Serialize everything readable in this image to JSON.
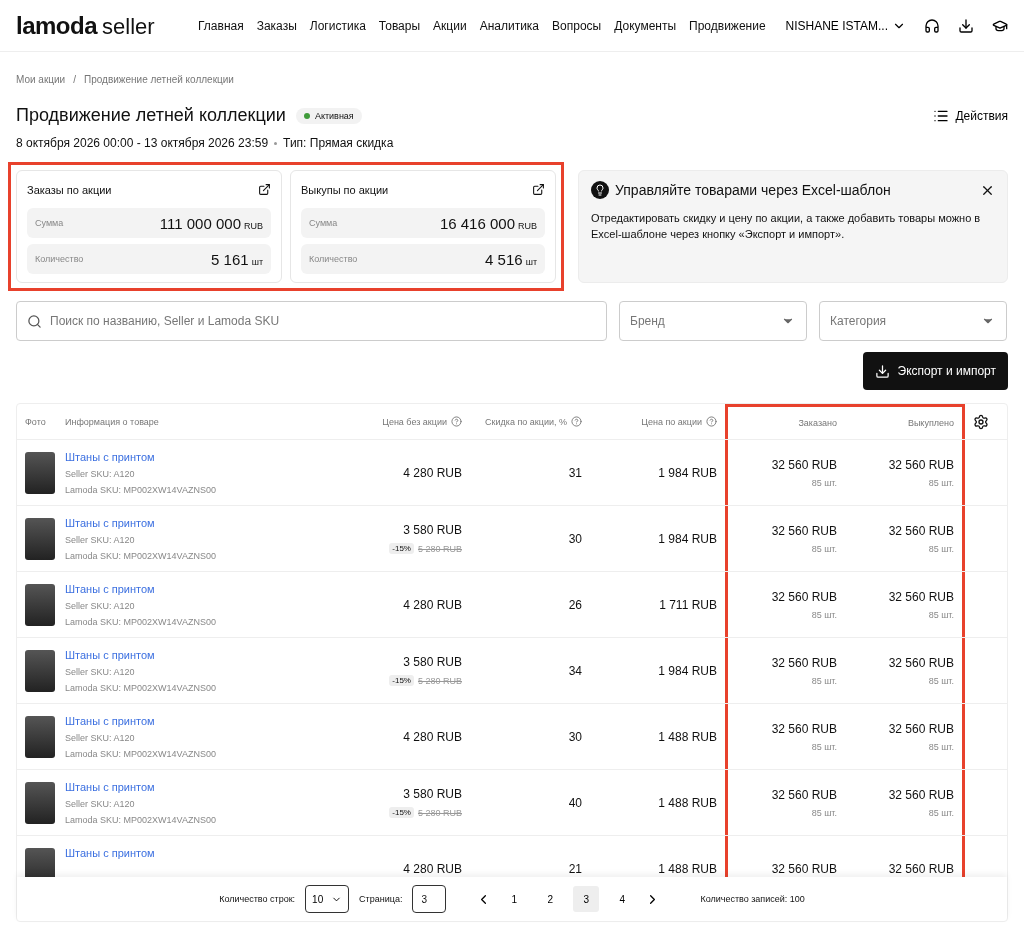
{
  "header": {
    "logo_main": "lamoda",
    "logo_sub": "seller",
    "nav": [
      "Главная",
      "Заказы",
      "Логистика",
      "Товары",
      "Акции",
      "Аналитика",
      "Вопросы",
      "Документы",
      "Продвижение"
    ],
    "account": "NISHANE ISTAM..."
  },
  "breadcrumbs": [
    "Мои акции",
    "/",
    "Продвижение летней коллекции"
  ],
  "title": "Продвижение летней коллекции",
  "status": {
    "label": "Активная",
    "color": "#3f9b3a"
  },
  "actions": "Действия",
  "period": "8 октября 2026 00:00 - 13 октября 2026 23:59",
  "type": "Тип: Прямая скидка",
  "stats": {
    "highlighted": true,
    "cards": [
      {
        "title": "Заказы по акции",
        "rows": [
          {
            "label": "Сумма",
            "value": "111 000 000",
            "unit": "RUB"
          },
          {
            "label": "Количество",
            "value": "5 161",
            "unit": "шт"
          }
        ]
      },
      {
        "title": "Выкупы по акции",
        "rows": [
          {
            "label": "Сумма",
            "value": "16 416 000",
            "unit": "RUB"
          },
          {
            "label": "Количество",
            "value": "4 516",
            "unit": "шт"
          }
        ]
      }
    ]
  },
  "tip": {
    "title": "Управляйте товарами через Excel-шаблон",
    "text": "Отредактировать скидку и цену по акции, а также добавить товары можно в Excel-шаблоне через кнопку «Экспорт и импорт»."
  },
  "filters": {
    "search_placeholder": "Поиск по названию, Seller и Lamoda SKU",
    "brand_placeholder": "Бренд",
    "category_placeholder": "Категория"
  },
  "export_button": "Экспорт и импорт",
  "table": {
    "columns": [
      {
        "label": "Фото",
        "help": false,
        "highlighted": false
      },
      {
        "label": "Информация о товаре",
        "help": false,
        "highlighted": false
      },
      {
        "label": "Цена без акции",
        "help": true,
        "highlighted": false
      },
      {
        "label": "Скидка по акции, %",
        "help": true,
        "highlighted": false
      },
      {
        "label": "Цена по акции",
        "help": true,
        "highlighted": false
      },
      {
        "label": "Заказано",
        "help": false,
        "highlighted": true
      },
      {
        "label": "Выкуплено",
        "help": false,
        "highlighted": true
      }
    ],
    "rows": [
      {
        "name": "Штаны с принтом",
        "seller_sku": "Seller SKU: A120",
        "lamoda_sku": "Lamoda SKU: MP002XW14VAZNS00",
        "price": "4 280 RUB",
        "discount": "31",
        "promo_price": "1 984 RUB",
        "ordered": "32 560 RUB",
        "ordered_qty": "85 шт.",
        "bought": "32 560 RUB",
        "bought_qty": "85 шт."
      },
      {
        "name": "Штаны с принтом",
        "seller_sku": "Seller SKU: A120",
        "lamoda_sku": "Lamoda SKU: MP002XW14VAZNS00",
        "price": "3 580 RUB",
        "old_discount": "-15%",
        "old_price": "5 280 RUB",
        "discount": "30",
        "promo_price": "1 984 RUB",
        "ordered": "32 560 RUB",
        "ordered_qty": "85 шт.",
        "bought": "32 560 RUB",
        "bought_qty": "85 шт."
      },
      {
        "name": "Штаны с принтом",
        "seller_sku": "Seller SKU: A120",
        "lamoda_sku": "Lamoda SKU: MP002XW14VAZNS00",
        "price": "4 280 RUB",
        "discount": "26",
        "promo_price": "1 711 RUB",
        "ordered": "32 560 RUB",
        "ordered_qty": "85 шт.",
        "bought": "32 560 RUB",
        "bought_qty": "85 шт."
      },
      {
        "name": "Штаны с принтом",
        "seller_sku": "Seller SKU: A120",
        "lamoda_sku": "Lamoda SKU: MP002XW14VAZNS00",
        "price": "3 580 RUB",
        "old_discount": "-15%",
        "old_price": "5 280 RUB",
        "discount": "34",
        "promo_price": "1 984 RUB",
        "ordered": "32 560 RUB",
        "ordered_qty": "85 шт.",
        "bought": "32 560 RUB",
        "bought_qty": "85 шт."
      },
      {
        "name": "Штаны с принтом",
        "seller_sku": "Seller SKU: A120",
        "lamoda_sku": "Lamoda SKU: MP002XW14VAZNS00",
        "price": "4 280 RUB",
        "discount": "30",
        "promo_price": "1 488 RUB",
        "ordered": "32 560 RUB",
        "ordered_qty": "85 шт.",
        "bought": "32 560 RUB",
        "bought_qty": "85 шт."
      },
      {
        "name": "Штаны с принтом",
        "seller_sku": "Seller SKU: A120",
        "lamoda_sku": "Lamoda SKU: MP002XW14VAZNS00",
        "price": "3 580 RUB",
        "old_discount": "-15%",
        "old_price": "5 280 RUB",
        "discount": "40",
        "promo_price": "1 488 RUB",
        "ordered": "32 560 RUB",
        "ordered_qty": "85 шт.",
        "bought": "32 560 RUB",
        "bought_qty": "85 шт."
      },
      {
        "name": "Штаны с принтом",
        "price": "4 280 RUB",
        "discount": "21",
        "promo_price": "1 488 RUB",
        "ordered": "32 560 RUB",
        "bought": "32 560 RUB"
      }
    ]
  },
  "pagination": {
    "rows_label": "Количество строк:",
    "rows_value": "10",
    "page_label": "Страница:",
    "page_value": "3",
    "pages": [
      {
        "label": "1",
        "selected": false
      },
      {
        "label": "2",
        "selected": false
      },
      {
        "label": "3",
        "selected": true
      },
      {
        "label": "4",
        "selected": false
      }
    ],
    "total": "Количество записей: 100"
  }
}
